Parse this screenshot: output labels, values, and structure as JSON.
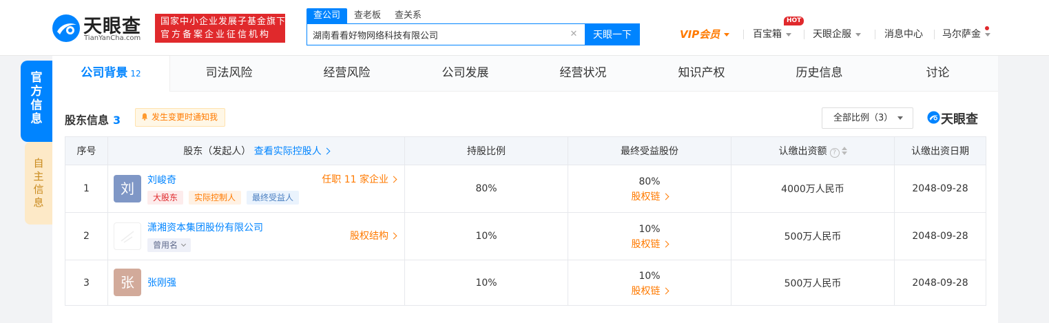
{
  "header": {
    "logo_cn": "天眼查",
    "logo_en": "TianYanCha.com",
    "slogan_line1": "国家中小企业发展子基金旗下",
    "slogan_line2": "官方备案企业征信机构",
    "search_tabs": [
      "查公司",
      "查老板",
      "查关系"
    ],
    "search_value": "湖南看看好物网络科技有限公司",
    "search_button": "天眼一下",
    "vip": "VIP会员",
    "baibaoxiang": "百宝箱",
    "hot_badge": "HOT",
    "qifu": "天眼企服",
    "messages": "消息中心",
    "user": "马尔萨金"
  },
  "side": {
    "official": [
      "官",
      "方",
      "信",
      "息"
    ],
    "self": [
      "自",
      "主",
      "信",
      "息"
    ]
  },
  "tabs": {
    "company_bg": "公司背景",
    "company_bg_count": "12",
    "judicial": "司法风险",
    "operation_risk": "经营风险",
    "development": "公司发展",
    "operation_status": "经营状况",
    "ip": "知识产权",
    "history": "历史信息",
    "discussion": "讨论"
  },
  "section": {
    "title": "股东信息",
    "count": "3",
    "notify": "发生变更时通知我",
    "ratio_filter": "全部比例（3）",
    "brand": "天眼查"
  },
  "table": {
    "headers": {
      "index": "序号",
      "holder": "股东（发起人）",
      "holder_link": "查看实际控股人",
      "ratio": "持股比例",
      "benefit": "最终受益股份",
      "amount": "认缴出资额",
      "date": "认缴出资日期"
    },
    "rows": [
      {
        "index": "1",
        "avatar": "刘",
        "avatar_color": "#7f97c6",
        "name": "刘峻奇",
        "right_link": "任职 11 家企业",
        "tags": [
          "大股东",
          "实际控制人",
          "最终受益人"
        ],
        "ratio": "80%",
        "benefit": "80%",
        "benefit_link": "股权链",
        "amount": "4000万人民币",
        "date": "2048-09-28"
      },
      {
        "index": "2",
        "name": "潇湘资本集团股份有限公司",
        "right_link": "股权结构",
        "tags": [
          "曾用名"
        ],
        "ratio": "10%",
        "benefit": "10%",
        "benefit_link": "股权链",
        "amount": "500万人民币",
        "date": "2048-09-28"
      },
      {
        "index": "3",
        "avatar": "张",
        "avatar_color": "#d2aa9a",
        "name": "张刚强",
        "ratio": "10%",
        "benefit": "10%",
        "benefit_link": "股权链",
        "amount": "500万人民币",
        "date": "2048-09-28"
      }
    ]
  },
  "colors": {
    "accent": "#0084ff",
    "orange": "#ff7a00",
    "red": "#e0292c"
  }
}
